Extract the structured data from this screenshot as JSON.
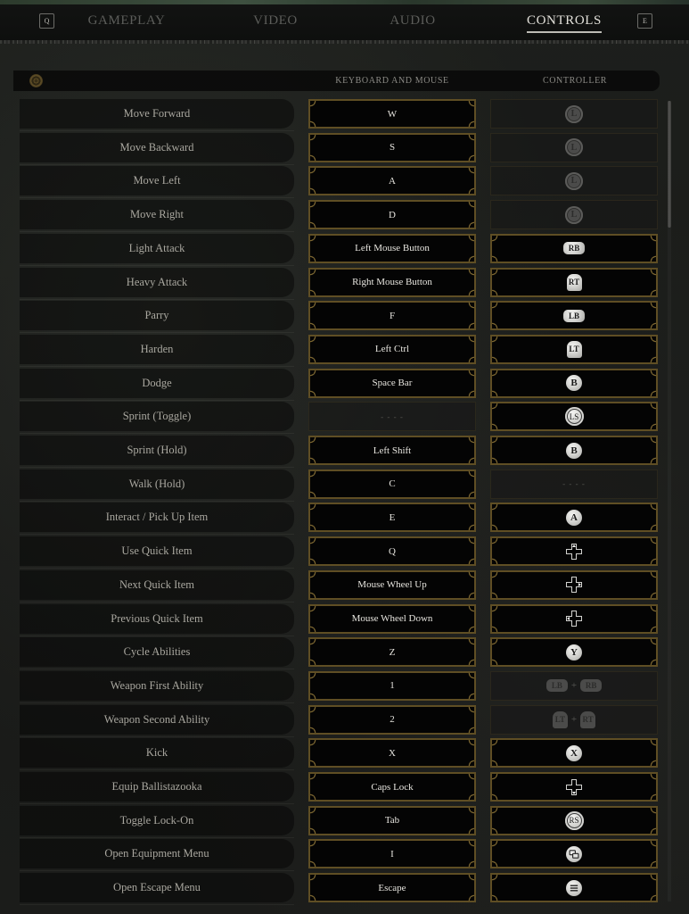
{
  "tabbar": {
    "prev_key": "Q",
    "next_key": "E",
    "tabs": [
      {
        "label": "GAMEPLAY",
        "active": false
      },
      {
        "label": "VIDEO",
        "active": false
      },
      {
        "label": "AUDIO",
        "active": false
      },
      {
        "label": "CONTROLS",
        "active": true
      }
    ]
  },
  "table_header": {
    "emblem_icon": "emblem-icon",
    "keyboard": "KEYBOARD AND MOUSE",
    "controller": "CONTROLLER"
  },
  "colors": {
    "frame_gold": "#5f4e24",
    "ornament_gold": "#7a6530",
    "active_tab": "#e2e0da",
    "inactive_tab": "#5c5d5a",
    "label_text": "#a9a79f",
    "binding_text": "#e7e5df"
  },
  "scrollbar": {
    "scroll_position": 0
  },
  "rows": [
    {
      "action": "Move Forward",
      "keyboard": {
        "value": "W",
        "state": "active"
      },
      "controller": {
        "state": "inactive",
        "glyphs": [
          {
            "type": "stick",
            "label": "L",
            "icon": "left-stick-icon"
          }
        ]
      }
    },
    {
      "action": "Move Backward",
      "keyboard": {
        "value": "S",
        "state": "active"
      },
      "controller": {
        "state": "inactive",
        "glyphs": [
          {
            "type": "stick",
            "label": "L",
            "icon": "left-stick-icon"
          }
        ]
      }
    },
    {
      "action": "Move Left",
      "keyboard": {
        "value": "A",
        "state": "active"
      },
      "controller": {
        "state": "inactive",
        "glyphs": [
          {
            "type": "stick",
            "label": "L",
            "icon": "left-stick-icon"
          }
        ]
      }
    },
    {
      "action": "Move Right",
      "keyboard": {
        "value": "D",
        "state": "active"
      },
      "controller": {
        "state": "inactive",
        "glyphs": [
          {
            "type": "stick",
            "label": "L",
            "icon": "left-stick-icon"
          }
        ]
      }
    },
    {
      "action": "Light Attack",
      "keyboard": {
        "value": "Left Mouse Button",
        "state": "active"
      },
      "controller": {
        "state": "active",
        "glyphs": [
          {
            "type": "bumper",
            "label": "RB",
            "icon": "right-bumper-icon"
          }
        ]
      }
    },
    {
      "action": "Heavy Attack",
      "keyboard": {
        "value": "Right Mouse Button",
        "state": "active"
      },
      "controller": {
        "state": "active",
        "glyphs": [
          {
            "type": "trigger",
            "label": "RT",
            "icon": "right-trigger-icon"
          }
        ]
      }
    },
    {
      "action": "Parry",
      "keyboard": {
        "value": "F",
        "state": "active"
      },
      "controller": {
        "state": "active",
        "glyphs": [
          {
            "type": "bumper",
            "label": "LB",
            "icon": "left-bumper-icon"
          }
        ]
      }
    },
    {
      "action": "Harden",
      "keyboard": {
        "value": "Left Ctrl",
        "state": "active"
      },
      "controller": {
        "state": "active",
        "glyphs": [
          {
            "type": "trigger",
            "label": "LT",
            "icon": "left-trigger-icon"
          }
        ]
      }
    },
    {
      "action": "Dodge",
      "keyboard": {
        "value": "Space Bar",
        "state": "active"
      },
      "controller": {
        "state": "active",
        "glyphs": [
          {
            "type": "face",
            "label": "B",
            "icon": "b-button-icon"
          }
        ]
      }
    },
    {
      "action": "Sprint (Toggle)",
      "keyboard": {
        "value": "- - - -",
        "state": "inactive"
      },
      "controller": {
        "state": "active",
        "glyphs": [
          {
            "type": "stick-click",
            "label": "LS",
            "icon": "left-stick-click-icon"
          }
        ]
      }
    },
    {
      "action": "Sprint (Hold)",
      "keyboard": {
        "value": "Left Shift",
        "state": "active"
      },
      "controller": {
        "state": "active",
        "glyphs": [
          {
            "type": "face",
            "label": "B",
            "icon": "b-button-icon"
          }
        ]
      }
    },
    {
      "action": "Walk (Hold)",
      "keyboard": {
        "value": "C",
        "state": "active"
      },
      "controller": {
        "state": "inactive",
        "text": "- - - -"
      }
    },
    {
      "action": "Interact / Pick Up Item",
      "keyboard": {
        "value": "E",
        "state": "active"
      },
      "controller": {
        "state": "active",
        "glyphs": [
          {
            "type": "face",
            "label": "A",
            "icon": "a-button-icon"
          }
        ]
      }
    },
    {
      "action": "Use Quick Item",
      "keyboard": {
        "value": "Q",
        "state": "active"
      },
      "controller": {
        "state": "active",
        "glyphs": [
          {
            "type": "dpad",
            "dir": "up",
            "icon": "dpad-up-icon"
          }
        ]
      }
    },
    {
      "action": "Next Quick Item",
      "keyboard": {
        "value": "Mouse Wheel Up",
        "state": "active"
      },
      "controller": {
        "state": "active",
        "glyphs": [
          {
            "type": "dpad",
            "dir": "right",
            "icon": "dpad-right-icon"
          }
        ]
      }
    },
    {
      "action": "Previous Quick Item",
      "keyboard": {
        "value": "Mouse Wheel Down",
        "state": "active"
      },
      "controller": {
        "state": "active",
        "glyphs": [
          {
            "type": "dpad",
            "dir": "left",
            "icon": "dpad-left-icon"
          }
        ]
      }
    },
    {
      "action": "Cycle Abilities",
      "keyboard": {
        "value": "Z",
        "state": "active"
      },
      "controller": {
        "state": "active",
        "glyphs": [
          {
            "type": "face",
            "label": "Y",
            "icon": "y-button-icon"
          }
        ]
      }
    },
    {
      "action": "Weapon First Ability",
      "keyboard": {
        "value": "1",
        "state": "active"
      },
      "controller": {
        "state": "inactive",
        "joiner": "+",
        "glyphs": [
          {
            "type": "bumper",
            "label": "LB",
            "icon": "left-bumper-icon"
          },
          {
            "type": "bumper",
            "label": "RB",
            "icon": "right-bumper-icon"
          }
        ]
      }
    },
    {
      "action": "Weapon Second Ability",
      "keyboard": {
        "value": "2",
        "state": "active"
      },
      "controller": {
        "state": "inactive",
        "joiner": "+",
        "glyphs": [
          {
            "type": "trigger",
            "label": "LT",
            "icon": "left-trigger-icon"
          },
          {
            "type": "trigger",
            "label": "RT",
            "icon": "right-trigger-icon"
          }
        ]
      }
    },
    {
      "action": "Kick",
      "keyboard": {
        "value": "X",
        "state": "active"
      },
      "controller": {
        "state": "active",
        "glyphs": [
          {
            "type": "face",
            "label": "X",
            "icon": "x-button-icon"
          }
        ]
      }
    },
    {
      "action": "Equip Ballistazooka",
      "keyboard": {
        "value": "Caps Lock",
        "state": "active"
      },
      "controller": {
        "state": "active",
        "glyphs": [
          {
            "type": "dpad",
            "dir": "down",
            "icon": "dpad-down-icon"
          }
        ]
      }
    },
    {
      "action": "Toggle Lock-On",
      "keyboard": {
        "value": "Tab",
        "state": "active"
      },
      "controller": {
        "state": "active",
        "glyphs": [
          {
            "type": "stick-click",
            "label": "RS",
            "icon": "right-stick-click-icon"
          }
        ]
      }
    },
    {
      "action": "Open Equipment Menu",
      "keyboard": {
        "value": "I",
        "state": "active"
      },
      "controller": {
        "state": "active",
        "glyphs": [
          {
            "type": "view",
            "icon": "view-button-icon"
          }
        ]
      }
    },
    {
      "action": "Open Escape Menu",
      "keyboard": {
        "value": "Escape",
        "state": "active"
      },
      "controller": {
        "state": "active",
        "glyphs": [
          {
            "type": "menu",
            "icon": "menu-button-icon"
          }
        ]
      }
    }
  ]
}
